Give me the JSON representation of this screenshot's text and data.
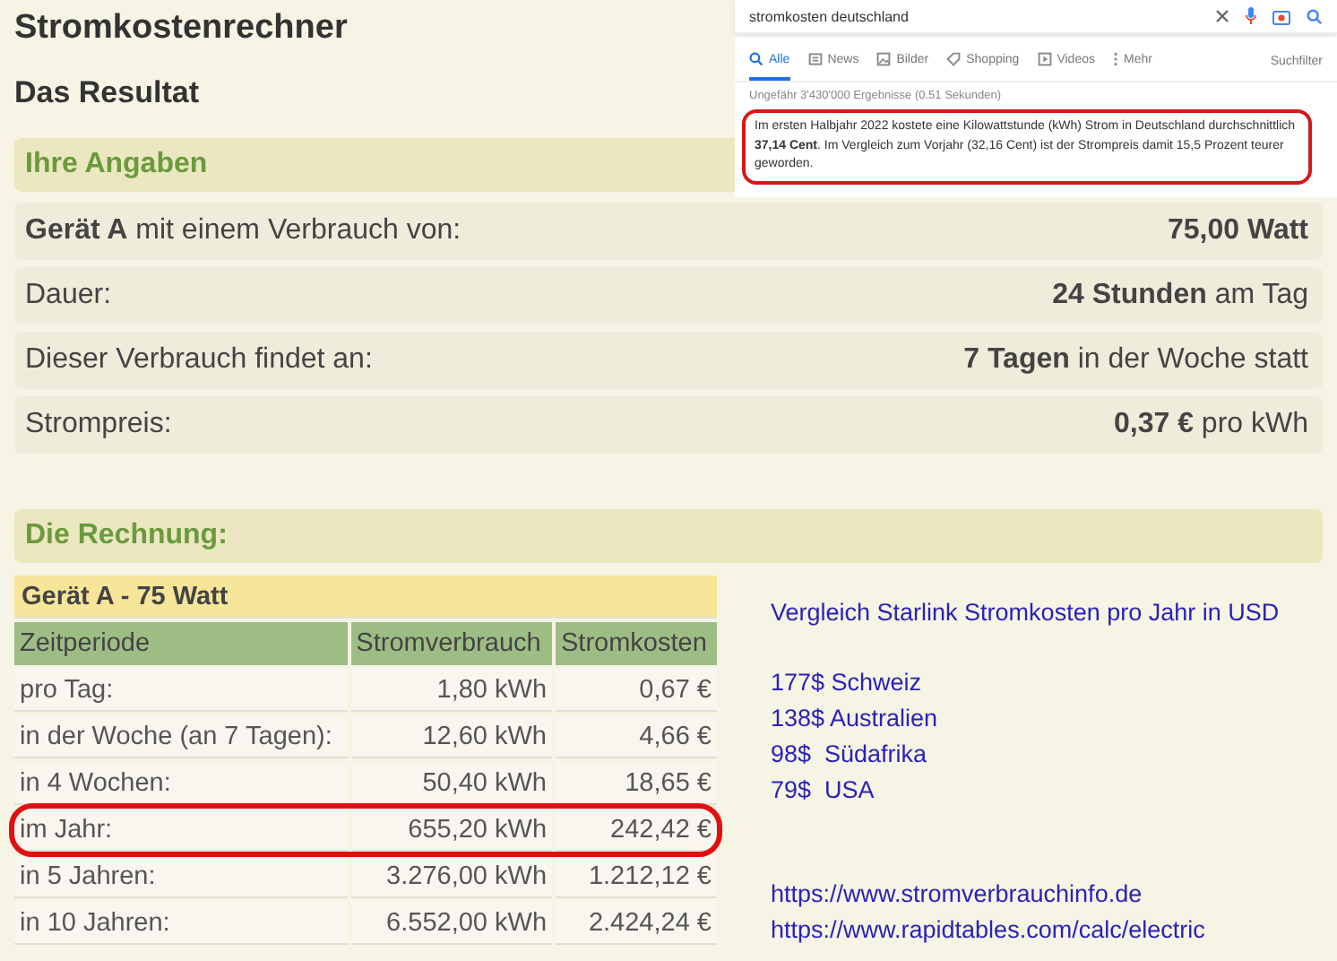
{
  "title": "Stromkostenrechner",
  "subtitle": "Das Resultat",
  "inputs": {
    "heading": "Ihre Angaben",
    "rows": [
      {
        "label": "**Gerät A** mit einem Verbrauch von:",
        "value": "**75,00 Watt**"
      },
      {
        "label": "Dauer:",
        "value": "**24 Stunden** am Tag"
      },
      {
        "label": "Dieser Verbrauch findet an:",
        "value": "**7 Tagen** in der Woche statt"
      },
      {
        "label": "Strompreis:",
        "value": "**0,37 €** pro kWh"
      }
    ]
  },
  "calculation": {
    "heading": "Die Rechnung:",
    "table": {
      "caption": "Gerät A - 75 Watt",
      "columns": [
        "Zeitperiode",
        "Stromverbrauch",
        "Stromkosten"
      ],
      "rows": [
        {
          "cells": [
            "pro Tag:",
            "1,80 kWh",
            "0,67 €"
          ],
          "highlighted": false
        },
        {
          "cells": [
            "in der Woche (an 7 Tagen):",
            "12,60 kWh",
            "4,66 €"
          ],
          "highlighted": false
        },
        {
          "cells": [
            "in 4 Wochen:",
            "50,40 kWh",
            "18,65 €"
          ],
          "highlighted": false
        },
        {
          "cells": [
            "im Jahr:",
            "655,20 kWh",
            "242,42 €"
          ],
          "highlighted": true
        },
        {
          "cells": [
            "in 5 Jahren:",
            "3.276,00 kWh",
            "1.212,12 €"
          ],
          "highlighted": false
        },
        {
          "cells": [
            "in 10 Jahren:",
            "6.552,00 kWh",
            "2.424,24 €"
          ],
          "highlighted": false
        }
      ]
    }
  },
  "note": {
    "heading": "Vergleich Starlink Stromkosten pro Jahr in USD",
    "lines": [
      "177$ Schweiz",
      "138$ Australien",
      "98$  Südafrika",
      "79$  USA"
    ],
    "links": [
      "https://www.stromverbrauchinfo.de",
      "https://www.rapidtables.com/calc/electric"
    ]
  },
  "search_overlay": {
    "query": "stromkosten deutschland",
    "tabs": [
      {
        "label": "Alle",
        "kind": "search",
        "selected": true
      },
      {
        "label": "News",
        "kind": "news",
        "selected": false
      },
      {
        "label": "Bilder",
        "kind": "image",
        "selected": false
      },
      {
        "label": "Shopping",
        "kind": "tag",
        "selected": false
      },
      {
        "label": "Videos",
        "kind": "video",
        "selected": false
      },
      {
        "label": "Mehr",
        "kind": "dots",
        "selected": false
      }
    ],
    "filter": "Suchfilter",
    "result_count": "Ungefähr 3'430'000 Ergebnisse (0.51 Sekunden)",
    "snippet": "Im ersten Halbjahr 2022 kostete eine Kilowattstunde (kWh) Strom in Deutschland durchschnittlich **37,14 Cent**. Im Vergleich zum Vorjahr (32,16 Cent) ist der Strompreis damit 15,5 Prozent teurer geworden."
  }
}
